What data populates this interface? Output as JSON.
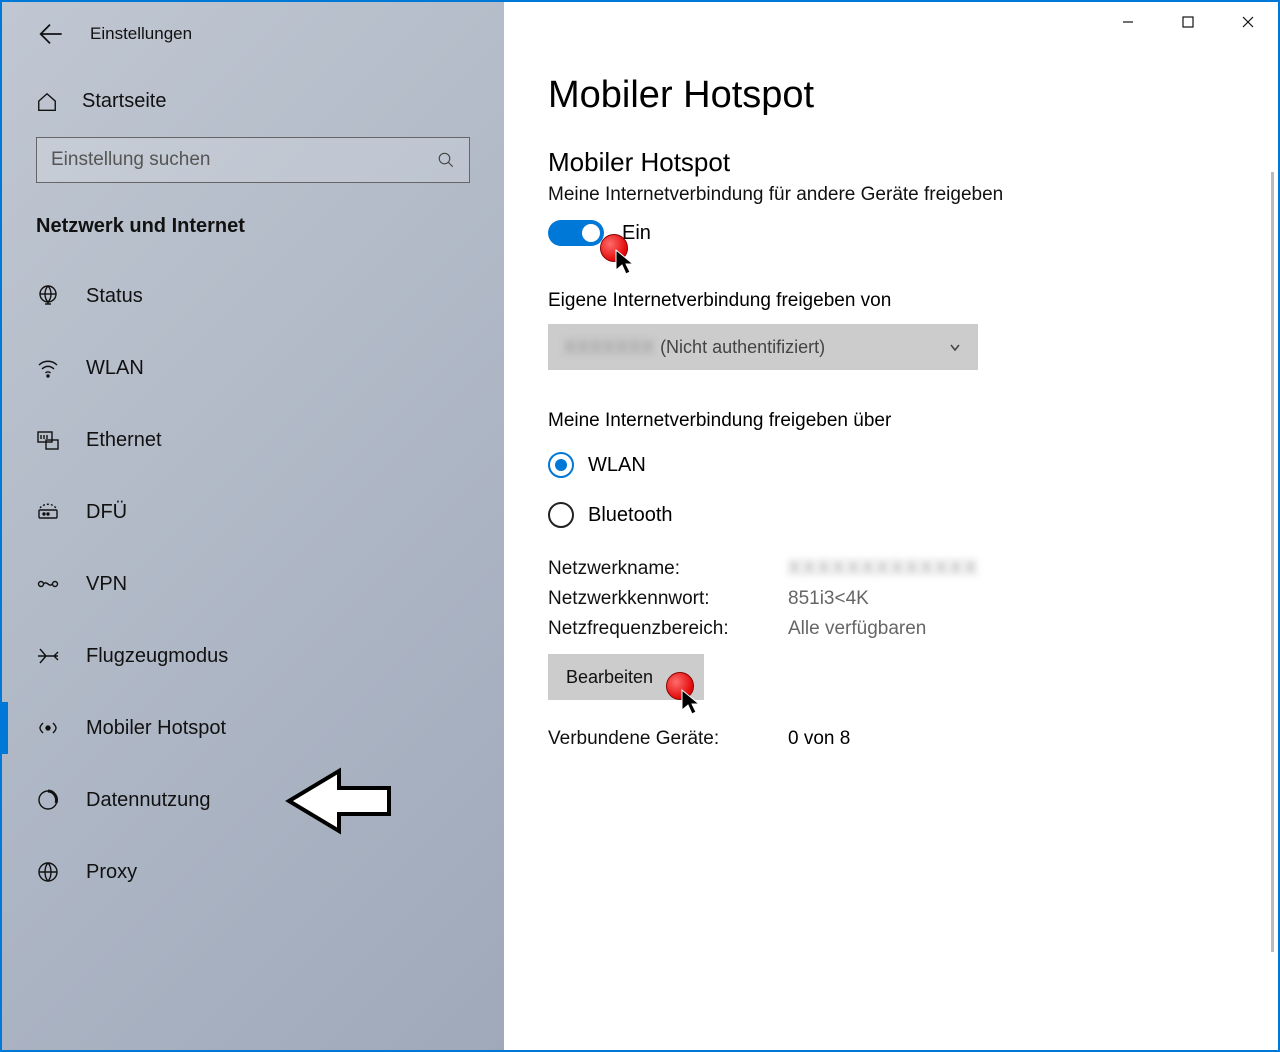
{
  "header": {
    "app_title": "Einstellungen"
  },
  "sidebar": {
    "home_label": "Startseite",
    "search_placeholder": "Einstellung suchen",
    "section_heading": "Netzwerk und Internet",
    "items": [
      {
        "label": "Status",
        "icon": "globe-status-icon"
      },
      {
        "label": "WLAN",
        "icon": "wifi-icon"
      },
      {
        "label": "Ethernet",
        "icon": "ethernet-icon"
      },
      {
        "label": "DFÜ",
        "icon": "dialup-icon"
      },
      {
        "label": "VPN",
        "icon": "vpn-icon"
      },
      {
        "label": "Flugzeugmodus",
        "icon": "airplane-icon"
      },
      {
        "label": "Mobiler Hotspot",
        "icon": "hotspot-icon"
      },
      {
        "label": "Datennutzung",
        "icon": "datausage-icon"
      },
      {
        "label": "Proxy",
        "icon": "proxy-icon"
      }
    ],
    "selected_index": 6
  },
  "main": {
    "page_title": "Mobiler Hotspot",
    "hotspot_header": "Mobiler Hotspot",
    "hotspot_desc": "Meine Internetverbindung für andere Geräte freigeben",
    "toggle_state_label": "Ein",
    "share_from_label": "Eigene Internetverbindung freigeben von",
    "share_from_value": "(Nicht authentifiziert)",
    "share_via_label": "Meine Internetverbindung freigeben über",
    "radio_options": [
      {
        "label": "WLAN",
        "checked": true
      },
      {
        "label": "Bluetooth",
        "checked": false
      }
    ],
    "info": {
      "name_key": "Netzwerkname:",
      "name_val": "",
      "pass_key": "Netzwerkkennwort:",
      "pass_val": "851i3<4K",
      "band_key": "Netzfrequenzbereich:",
      "band_val": "Alle verfügbaren"
    },
    "edit_button": "Bearbeiten",
    "connected_key": "Verbundene Geräte:",
    "connected_val": "0 von 8"
  },
  "colors": {
    "accent": "#0078d7"
  }
}
